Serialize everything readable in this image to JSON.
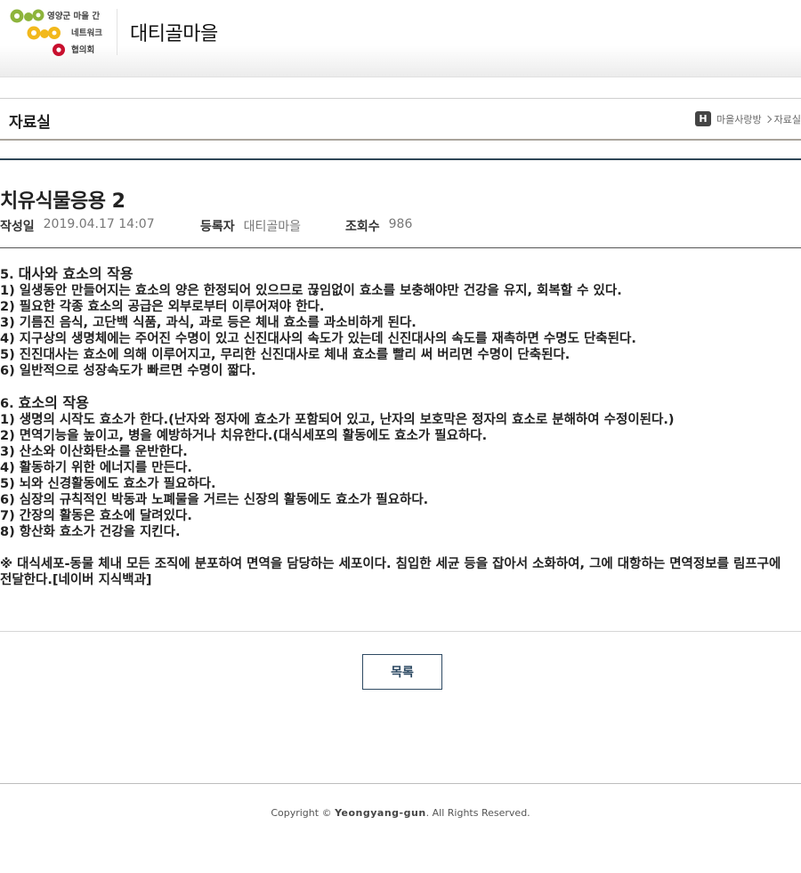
{
  "header": {
    "logo_text": [
      "영양군 마을 간",
      "네트워크",
      "협의회"
    ],
    "site_title": "대티골마을"
  },
  "subbar": {
    "page_title": "자료실",
    "breadcrumb": {
      "home_label": "H",
      "items": [
        "마을사랑방",
        "자료실"
      ]
    }
  },
  "post": {
    "title": "치유식물응용 2",
    "meta": {
      "date_label": "작성일",
      "date": "2019.04.17 14:07",
      "author_label": "등록자",
      "author": "대티골마을",
      "views_label": "조회수",
      "views": "986"
    },
    "sections": [
      {
        "heading_num": "5.",
        "heading": "대사와 효소의 작용",
        "lines": [
          "1) 일생동안 만들어지는 효소의 양은 한정되어 있으므로 끊임없이 효소를 보충해야만 건강을 유지, 회복할 수 있다.",
          "2) 필요한 각종 효소의 공급은 외부로부터 이루어져야 한다.",
          "3) 기름진 음식, 고단백 식품, 과식, 과로 등은 체내 효소를 과소비하게 된다.",
          "4) 지구상의 생명체에는 주어진 수명이 있고 신진대사의 속도가 있는데 신진대사의 속도를 재촉하면 수명도 단축된다.",
          "5) 진진대사는 효소에 의해 이루어지고, 무리한 신진대사로 체내 효소를 빨리 써 버리면 수명이 단축된다.",
          "6) 일반적으로 성장속도가 빠르면 수명이 짧다."
        ]
      },
      {
        "heading_num": "6.",
        "heading": "효소의 작용",
        "lines": [
          "1) 생명의 시작도 효소가 한다.(난자와 정자에 효소가 포함되어 있고, 난자의 보호막은 정자의 효소로 분해하여 수정이된다.)",
          "2) 면역기능을 높이고, 병을 예방하거나 치유한다.(대식세포의 활동에도 효소가 필요하다.",
          "3) 산소와 이산화탄소를 운반한다.",
          "4) 활동하기 위한 에너지를 만든다.",
          "5) 뇌와 신경활동에도 효소가 필요하다.",
          "6) 심장의 규칙적인 박동과 노폐물을 거르는 신장의 활동에도 효소가 필요하다.",
          "7) 간장의 활동은 효소에 달려있다.",
          "8) 항산화 효소가 건강을 지킨다."
        ]
      }
    ],
    "note": "※ 대식세포-동물 체내 모든 조직에 분포하여 면역을 담당하는 세포이다. 침입한 세균 등을 잡아서 소화하여, 그에 대항하는 면역정보를 림프구에 전달한다.[네이버 지식백과]"
  },
  "list_button": "목록",
  "footer": {
    "prefix": "Copyright © ",
    "brand": "Yeongyang-gun",
    "suffix": ". All Rights Reserved."
  },
  "colors": {
    "accent": "#2e4a63",
    "logo_green": "#8db43c",
    "logo_yellow": "#f2b81c",
    "logo_red": "#c8102e"
  }
}
